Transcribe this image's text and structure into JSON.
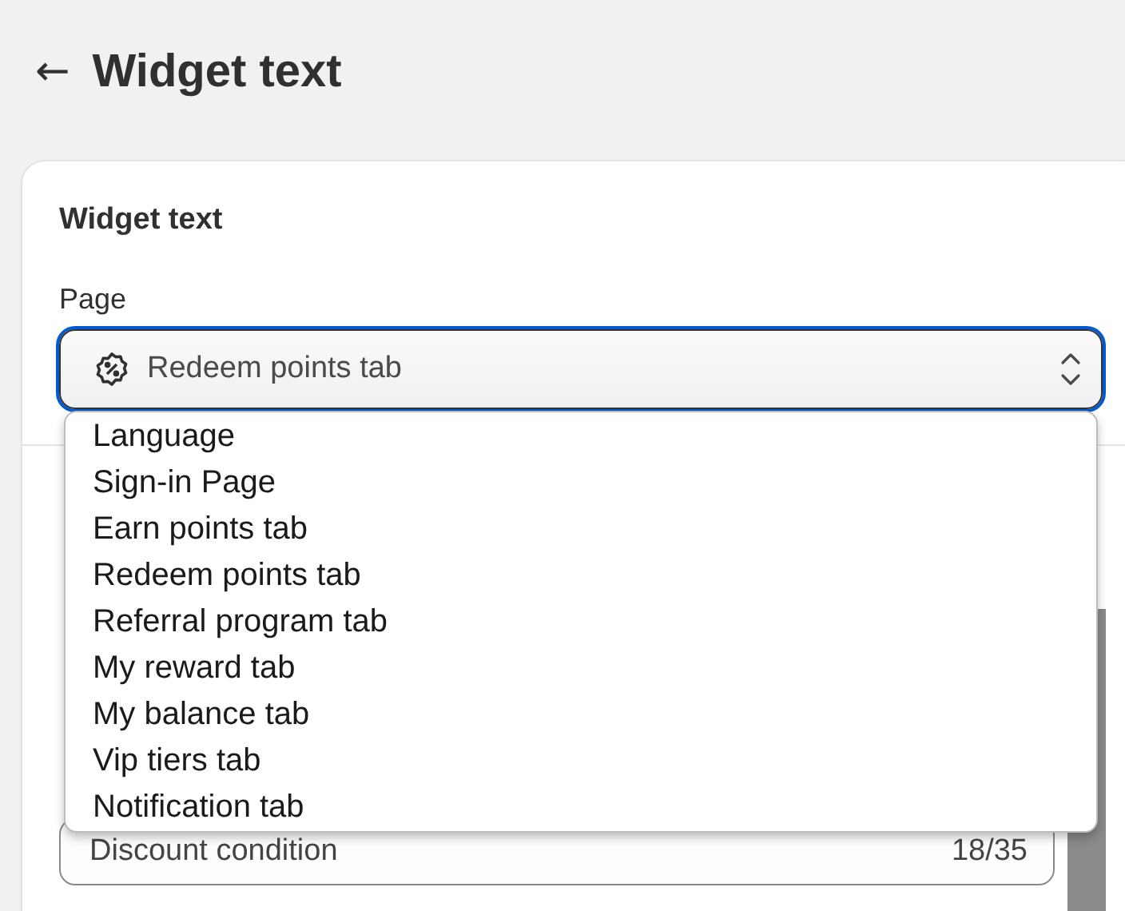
{
  "header": {
    "back": "←",
    "title": "Widget text"
  },
  "card": {
    "title": "Widget text",
    "page_select": {
      "label": "Page",
      "value": "Redeem points tab",
      "expanded": true,
      "options": [
        "Language",
        "Sign-in Page",
        "Earn points tab",
        "Redeem points tab",
        "Referral program tab",
        "My reward tab",
        "My balance tab",
        "Vip tiers tab",
        "Notification tab"
      ]
    },
    "field": {
      "value": "Discount condition",
      "count": "18/35"
    }
  }
}
